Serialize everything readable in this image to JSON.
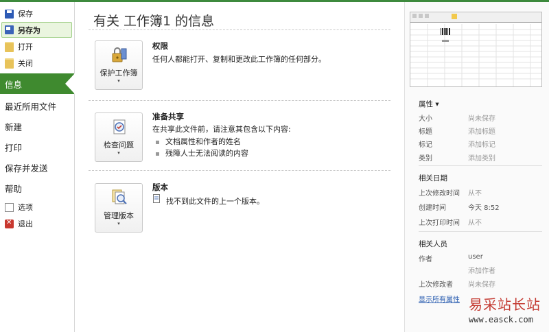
{
  "nav": {
    "small_top": [
      {
        "label": "保存"
      },
      {
        "label": "另存为"
      },
      {
        "label": "打开"
      },
      {
        "label": "关闭"
      }
    ],
    "info": "信息",
    "big": [
      {
        "label": "最近所用文件"
      },
      {
        "label": "新建"
      },
      {
        "label": "打印"
      },
      {
        "label": "保存并发送"
      },
      {
        "label": "帮助"
      }
    ],
    "small_bottom": [
      {
        "label": "选项"
      },
      {
        "label": "退出"
      }
    ]
  },
  "main": {
    "title": "有关 工作簿1 的信息",
    "permissions": {
      "button_label": "保护工作簿",
      "title": "权限",
      "text": "任何人都能打开、复制和更改此工作簿的任何部分。"
    },
    "prepare": {
      "button_label": "检查问题",
      "title": "准备共享",
      "text": "在共享此文件前，请注意其包含以下内容:",
      "bullets": [
        "文档属性和作者的姓名",
        "残障人士无法阅读的内容"
      ]
    },
    "versions": {
      "button_label": "管理版本",
      "title": "版本",
      "text": "找不到此文件的上一个版本。"
    },
    "dropdown_glyph": "▾"
  },
  "right": {
    "props_header": "属性 ▾",
    "props": [
      {
        "k": "大小",
        "v": "尚未保存"
      },
      {
        "k": "标题",
        "v": "添加标题"
      },
      {
        "k": "标记",
        "v": "添加标记"
      },
      {
        "k": "类别",
        "v": "添加类别"
      }
    ],
    "dates_header": "相关日期",
    "dates": [
      {
        "k": "上次修改时间",
        "v": "从不"
      },
      {
        "k": "创建时间",
        "v": "今天 8:52"
      },
      {
        "k": "上次打印时间",
        "v": "从不"
      }
    ],
    "people_header": "相关人员",
    "author_key": "作者",
    "author_value": "user",
    "add_author": "添加作者",
    "last_modified_key": "上次修改者",
    "last_modified_value": "尚未保存",
    "show_all": "显示所有属性"
  },
  "watermark": {
    "line1": "易采站长站",
    "line2": "www.easck.com"
  },
  "colors": {
    "accent_green": "#3f8a2f",
    "watermark_red": "#c43a32"
  }
}
